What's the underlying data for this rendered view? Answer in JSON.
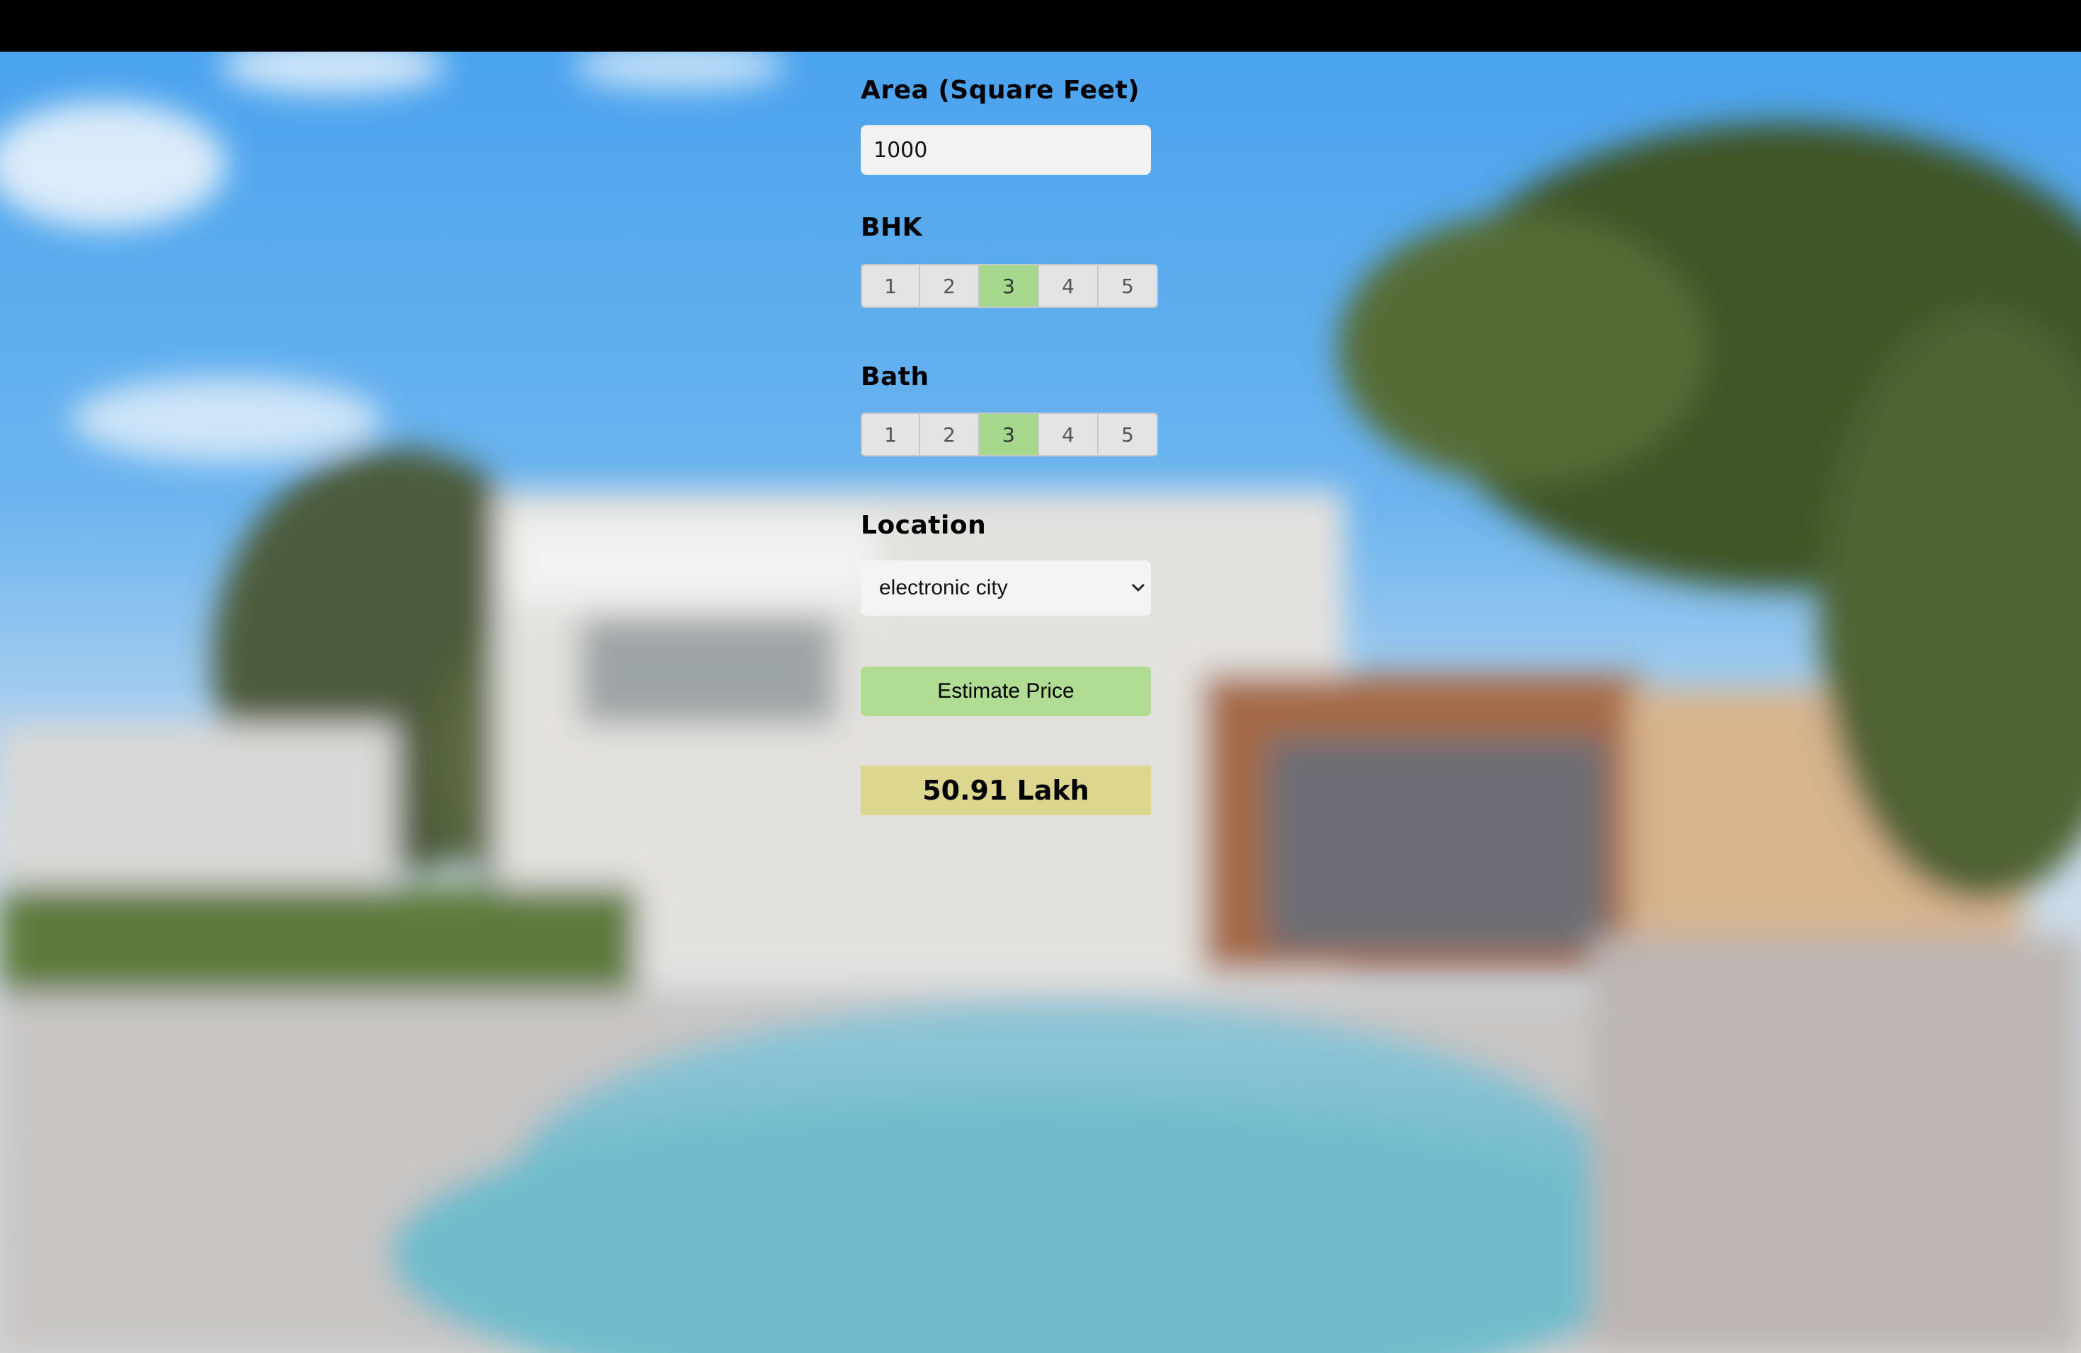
{
  "form": {
    "area": {
      "label": "Area (Square Feet)",
      "value": "1000"
    },
    "bhk": {
      "label": "BHK",
      "options": [
        "1",
        "2",
        "3",
        "4",
        "5"
      ],
      "selected": "3"
    },
    "bath": {
      "label": "Bath",
      "options": [
        "1",
        "2",
        "3",
        "4",
        "5"
      ],
      "selected": "3"
    },
    "location": {
      "label": "Location",
      "selected": "electronic city"
    },
    "estimate_button": "Estimate Price",
    "result": "50.91 Lakh"
  },
  "colors": {
    "selected_option": "#a5d88d",
    "estimate_button": "#b0dc93",
    "result_background": "#dcd68f"
  }
}
